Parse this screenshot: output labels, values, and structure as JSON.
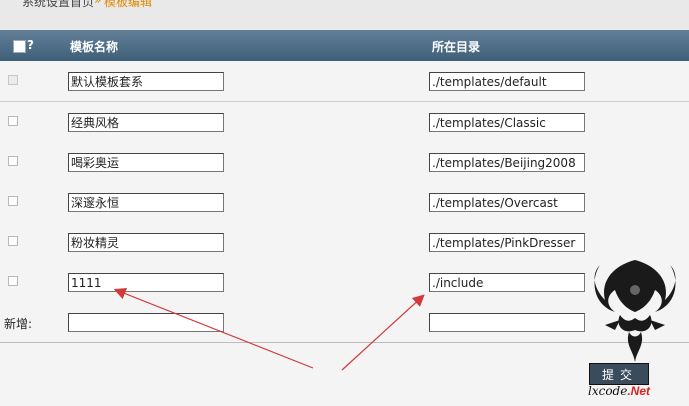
{
  "breadcrumb": {
    "home": "系统设置首页",
    "separator": "»",
    "current": "模板编辑"
  },
  "header": {
    "select_all_label": "?",
    "col_name": "模板名称",
    "col_dir": "所在目录"
  },
  "rows": [
    {
      "name": "默认模板套系",
      "dir": "./templates/default",
      "disabled": true
    },
    {
      "name": "经典风格",
      "dir": "./templates/Classic",
      "disabled": false
    },
    {
      "name": "喝彩奥运",
      "dir": "./templates/Beijing2008",
      "disabled": false
    },
    {
      "name": "深邃永恒",
      "dir": "./templates/Overcast",
      "disabled": false
    },
    {
      "name": "粉妆精灵",
      "dir": "./templates/PinkDresser",
      "disabled": false
    },
    {
      "name": "1111",
      "dir": "./include",
      "disabled": false
    }
  ],
  "new_row": {
    "label": "新增:",
    "name": "",
    "dir": ""
  },
  "submit_label": "提交",
  "watermark": {
    "prefix": "lxcode",
    "suffix": ".Net"
  },
  "colors": {
    "header_bg": "#4a6882",
    "accent": "#e08a00",
    "arrow": "#d23a3a"
  }
}
